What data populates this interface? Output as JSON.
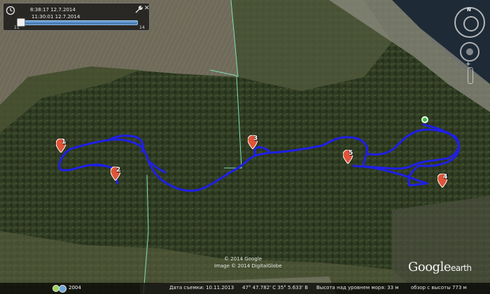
{
  "time_slider": {
    "start_time": "8:38:17 12.7.2014",
    "end_time": "11:30:01 12.7.2014",
    "start_label": "11",
    "end_label": "14"
  },
  "compass": {
    "north_label": "N"
  },
  "markers": [
    {
      "label": "1"
    },
    {
      "label": "2"
    },
    {
      "label": "3"
    },
    {
      "label": "4"
    },
    {
      "label": "5"
    }
  ],
  "copyright": {
    "line1": "© 2014 Google",
    "line2": "Image © 2014 DigitalGlobe"
  },
  "logo": {
    "google": "Google",
    "earth": "earth"
  },
  "status_bar": {
    "year": "2004",
    "date_label": "Дата съемки: 10.11.2013",
    "coordinates": "47° 47.782' С  35° 5.633' В",
    "elevation": "Высота над уровнем моря:    33 м",
    "altitude": "обзор с высоты   773 м"
  },
  "colors": {
    "track": "#1f1fe6",
    "marker": "#e0553a",
    "boundary": "#7fe0b8"
  },
  "icons": {
    "time": "clock-icon",
    "wrench": "wrench-icon",
    "close": "close-icon",
    "start": "start-point-icon"
  }
}
